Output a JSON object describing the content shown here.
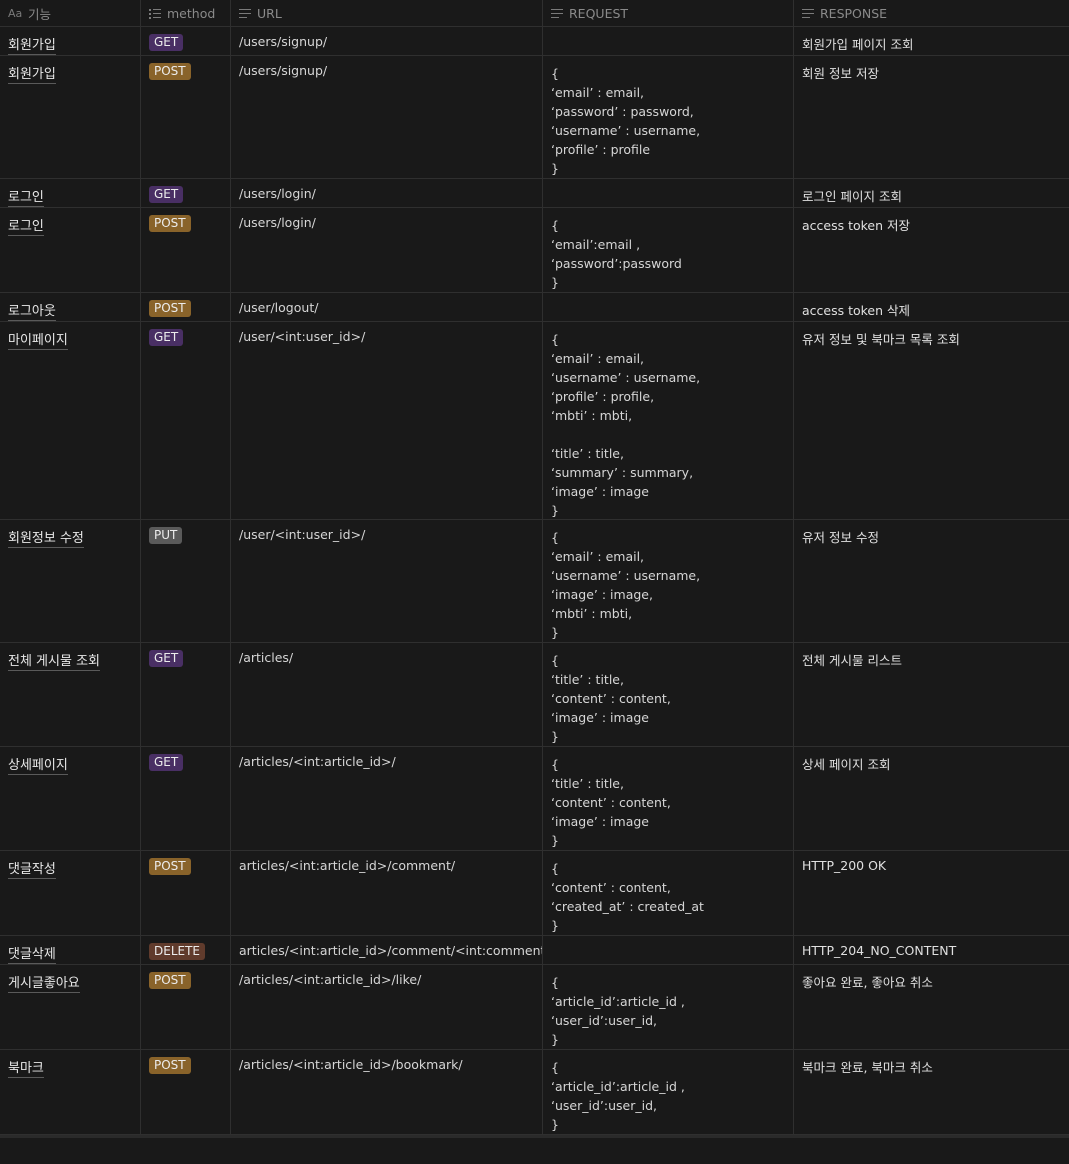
{
  "headers": {
    "feature": "기능",
    "method": "method",
    "url": "URL",
    "request": "REQUEST",
    "response": "RESPONSE",
    "feature_icon_text": "Aa"
  },
  "method_colors": {
    "GET": "#492f64",
    "POST": "#89632a",
    "PUT": "#5a5a5a",
    "DELETE": "#603b2c"
  },
  "rows": [
    {
      "feature": "회원가입",
      "method": "GET",
      "url": "/users/signup/",
      "request": "",
      "response": "회원가입 페이지 조회"
    },
    {
      "feature": "회원가입",
      "method": "POST",
      "url": "/users/signup/",
      "request": "{\n‘email’ : email,\n‘password’ : password,\n‘username’ : username,\n‘profile’ : profile\n}",
      "response": "회원 정보 저장"
    },
    {
      "feature": "로그인",
      "method": "GET",
      "url": "/users/login/",
      "request": "",
      "response": "로그인 페이지 조회"
    },
    {
      "feature": "로그인",
      "method": "POST",
      "url": "/users/login/",
      "request": "{\n‘email’:email ,\n‘password’:password\n}",
      "response": "access token 저장"
    },
    {
      "feature": "로그아웃",
      "method": "POST",
      "url": "/user/logout/",
      "request": "",
      "response": "access token 삭제"
    },
    {
      "feature": "마이페이지",
      "method": "GET",
      "url": "/user/<int:user_id>/",
      "request": "{\n‘email’ : email,\n‘username’ : username,\n‘profile’ : profile,\n‘mbti’ : mbti,\n\n‘title’ : title,\n‘summary’ : summary,\n‘image’ : image\n}",
      "response": "유저 정보 및 북마크 목록 조회"
    },
    {
      "feature": "회원정보 수정",
      "method": "PUT",
      "url": "/user/<int:user_id>/",
      "request": "{\n‘email’ : email,\n‘username’ : username,\n‘image’ : image,\n‘mbti’ : mbti,\n}",
      "response": "유저 정보 수정"
    },
    {
      "feature": "전체 게시물 조회",
      "method": "GET",
      "url": "/articles/",
      "request": "{\n‘title’ : title,\n‘content’ : content,\n‘image’ : image\n}",
      "response": "전체 게시물 리스트"
    },
    {
      "feature": "상세페이지",
      "method": "GET",
      "url": "/articles/<int:article_id>/",
      "request": "{\n‘title’ : title,\n‘content’ : content,\n‘image’ : image\n}",
      "response": "상세 페이지 조회"
    },
    {
      "feature": "댓글작성",
      "method": "POST",
      "url": "articles/<int:article_id>/comment/",
      "request": "{\n‘content’ : content,\n‘created_at’ : created_at\n}",
      "response": "HTTP_200 OK"
    },
    {
      "feature": "댓글삭제",
      "method": "DELETE",
      "url": "articles/<int:article_id>/comment/<int:comment_id>/",
      "request": "",
      "response": "HTTP_204_NO_CONTENT"
    },
    {
      "feature": "게시글좋아요",
      "method": "POST",
      "url": "/articles/<int:article_id>/like/",
      "request": "{\n‘article_id’:article_id ,\n‘user_id’:user_id,\n}",
      "response": "좋아요 완료, 좋아요 취소"
    },
    {
      "feature": "북마크",
      "method": "POST",
      "url": "/articles/<int:article_id>/bookmark/",
      "request": "{\n‘article_id’:article_id ,\n‘user_id’:user_id,\n}",
      "response": "북마크 완료, 북마크 취소"
    }
  ]
}
